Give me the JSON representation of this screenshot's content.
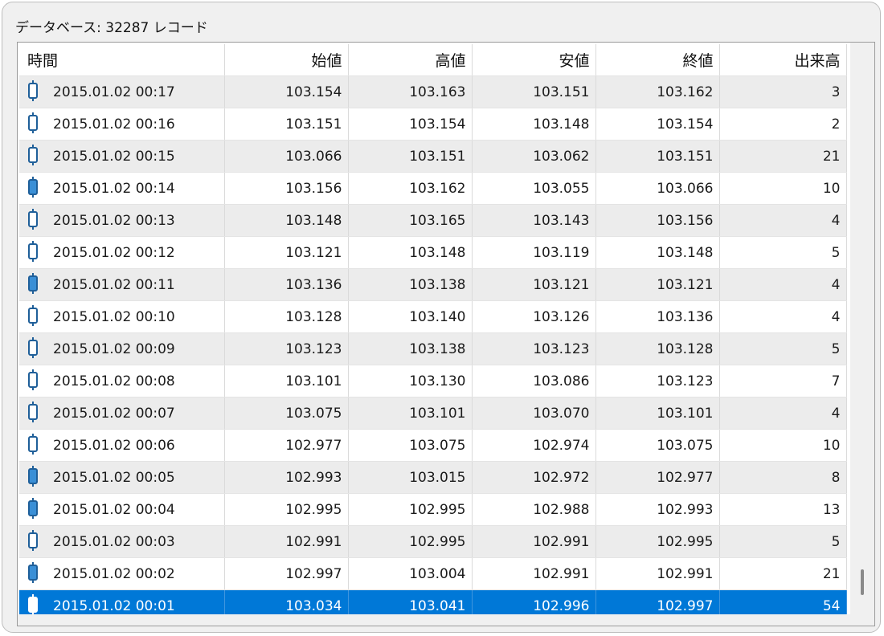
{
  "group": {
    "title": "データベース: 32287 レコード"
  },
  "columns": [
    "時間",
    "始値",
    "高値",
    "安値",
    "終値",
    "出来高"
  ],
  "rows": [
    {
      "time": "2015.01.02 00:17",
      "open": "103.154",
      "high": "103.163",
      "low": "103.151",
      "close": "103.162",
      "volume": "3",
      "candle": "bullish"
    },
    {
      "time": "2015.01.02 00:16",
      "open": "103.151",
      "high": "103.154",
      "low": "103.148",
      "close": "103.154",
      "volume": "2",
      "candle": "bullish"
    },
    {
      "time": "2015.01.02 00:15",
      "open": "103.066",
      "high": "103.151",
      "low": "103.062",
      "close": "103.151",
      "volume": "21",
      "candle": "bullish"
    },
    {
      "time": "2015.01.02 00:14",
      "open": "103.156",
      "high": "103.162",
      "low": "103.055",
      "close": "103.066",
      "volume": "10",
      "candle": "bearish"
    },
    {
      "time": "2015.01.02 00:13",
      "open": "103.148",
      "high": "103.165",
      "low": "103.143",
      "close": "103.156",
      "volume": "4",
      "candle": "bullish"
    },
    {
      "time": "2015.01.02 00:12",
      "open": "103.121",
      "high": "103.148",
      "low": "103.119",
      "close": "103.148",
      "volume": "5",
      "candle": "bullish"
    },
    {
      "time": "2015.01.02 00:11",
      "open": "103.136",
      "high": "103.138",
      "low": "103.121",
      "close": "103.121",
      "volume": "4",
      "candle": "bearish"
    },
    {
      "time": "2015.01.02 00:10",
      "open": "103.128",
      "high": "103.140",
      "low": "103.126",
      "close": "103.136",
      "volume": "4",
      "candle": "bullish"
    },
    {
      "time": "2015.01.02 00:09",
      "open": "103.123",
      "high": "103.138",
      "low": "103.123",
      "close": "103.128",
      "volume": "5",
      "candle": "bullish"
    },
    {
      "time": "2015.01.02 00:08",
      "open": "103.101",
      "high": "103.130",
      "low": "103.086",
      "close": "103.123",
      "volume": "7",
      "candle": "bullish"
    },
    {
      "time": "2015.01.02 00:07",
      "open": "103.075",
      "high": "103.101",
      "low": "103.070",
      "close": "103.101",
      "volume": "4",
      "candle": "bullish"
    },
    {
      "time": "2015.01.02 00:06",
      "open": "102.977",
      "high": "103.075",
      "low": "102.974",
      "close": "103.075",
      "volume": "10",
      "candle": "bullish"
    },
    {
      "time": "2015.01.02 00:05",
      "open": "102.993",
      "high": "103.015",
      "low": "102.972",
      "close": "102.977",
      "volume": "8",
      "candle": "bearish"
    },
    {
      "time": "2015.01.02 00:04",
      "open": "102.995",
      "high": "102.995",
      "low": "102.988",
      "close": "102.993",
      "volume": "13",
      "candle": "bearish"
    },
    {
      "time": "2015.01.02 00:03",
      "open": "102.991",
      "high": "102.995",
      "low": "102.991",
      "close": "102.995",
      "volume": "5",
      "candle": "bullish"
    },
    {
      "time": "2015.01.02 00:02",
      "open": "102.997",
      "high": "103.004",
      "low": "102.991",
      "close": "102.991",
      "volume": "21",
      "candle": "bearish"
    },
    {
      "time": "2015.01.02 00:01",
      "open": "103.034",
      "high": "103.041",
      "low": "102.996",
      "close": "102.997",
      "volume": "54",
      "candle": "bearish",
      "selected": true
    }
  ],
  "colors": {
    "accent": "#0078d7",
    "candle_stroke": "#1f5f99",
    "candle_fill": "#3a8fd6",
    "selected_candle": "#ffffff"
  }
}
